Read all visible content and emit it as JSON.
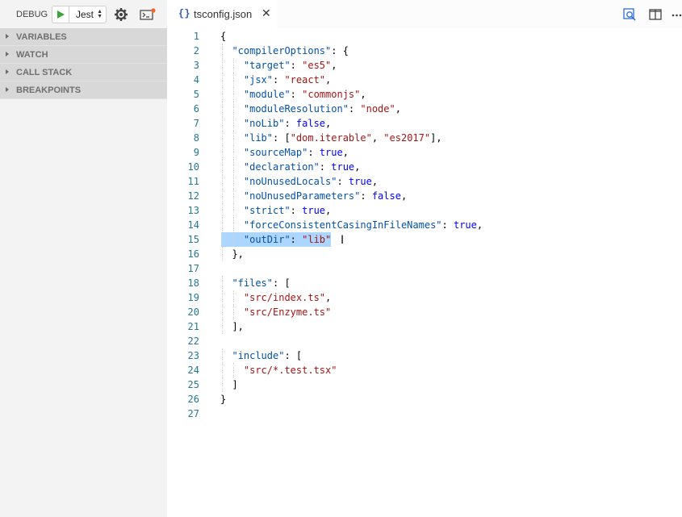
{
  "debug": {
    "label": "DEBUG",
    "configuration": "Jest",
    "sections": [
      {
        "label": "VARIABLES"
      },
      {
        "label": "WATCH"
      },
      {
        "label": "CALL STACK"
      },
      {
        "label": "BREAKPOINTS"
      }
    ]
  },
  "editor": {
    "tab": {
      "icon": "{}",
      "label": "tsconfig.json",
      "close": "✕"
    },
    "cursor": "I",
    "lines": [
      {
        "n": "1",
        "t": [
          {
            "c": "p",
            "v": "{"
          }
        ]
      },
      {
        "n": "2",
        "t": [
          {
            "c": "k",
            "v": "\"compilerOptions\""
          },
          {
            "c": "p",
            "v": ": {"
          }
        ]
      },
      {
        "n": "3",
        "t": [
          {
            "c": "k",
            "v": "\"target\""
          },
          {
            "c": "p",
            "v": ": "
          },
          {
            "c": "s",
            "v": "\"es5\""
          },
          {
            "c": "p",
            "v": ","
          }
        ]
      },
      {
        "n": "4",
        "t": [
          {
            "c": "k",
            "v": "\"jsx\""
          },
          {
            "c": "p",
            "v": ": "
          },
          {
            "c": "s",
            "v": "\"react\""
          },
          {
            "c": "p",
            "v": ","
          }
        ]
      },
      {
        "n": "5",
        "t": [
          {
            "c": "k",
            "v": "\"module\""
          },
          {
            "c": "p",
            "v": ": "
          },
          {
            "c": "s",
            "v": "\"commonjs\""
          },
          {
            "c": "p",
            "v": ","
          }
        ]
      },
      {
        "n": "6",
        "t": [
          {
            "c": "k",
            "v": "\"moduleResolution\""
          },
          {
            "c": "p",
            "v": ": "
          },
          {
            "c": "s",
            "v": "\"node\""
          },
          {
            "c": "p",
            "v": ","
          }
        ]
      },
      {
        "n": "7",
        "t": [
          {
            "c": "k",
            "v": "\"noLib\""
          },
          {
            "c": "p",
            "v": ": "
          },
          {
            "c": "b",
            "v": "false"
          },
          {
            "c": "p",
            "v": ","
          }
        ]
      },
      {
        "n": "8",
        "t": [
          {
            "c": "k",
            "v": "\"lib\""
          },
          {
            "c": "p",
            "v": ": ["
          },
          {
            "c": "s",
            "v": "\"dom.iterable\""
          },
          {
            "c": "p",
            "v": ", "
          },
          {
            "c": "s",
            "v": "\"es2017\""
          },
          {
            "c": "p",
            "v": "],"
          }
        ]
      },
      {
        "n": "9",
        "t": [
          {
            "c": "k",
            "v": "\"sourceMap\""
          },
          {
            "c": "p",
            "v": ": "
          },
          {
            "c": "b",
            "v": "true"
          },
          {
            "c": "p",
            "v": ","
          }
        ]
      },
      {
        "n": "10",
        "t": [
          {
            "c": "k",
            "v": "\"declaration\""
          },
          {
            "c": "p",
            "v": ": "
          },
          {
            "c": "b",
            "v": "true"
          },
          {
            "c": "p",
            "v": ","
          }
        ]
      },
      {
        "n": "11",
        "t": [
          {
            "c": "k",
            "v": "\"noUnusedLocals\""
          },
          {
            "c": "p",
            "v": ": "
          },
          {
            "c": "b",
            "v": "true"
          },
          {
            "c": "p",
            "v": ","
          }
        ]
      },
      {
        "n": "12",
        "t": [
          {
            "c": "k",
            "v": "\"noUnusedParameters\""
          },
          {
            "c": "p",
            "v": ": "
          },
          {
            "c": "b",
            "v": "false"
          },
          {
            "c": "p",
            "v": ","
          }
        ]
      },
      {
        "n": "13",
        "t": [
          {
            "c": "k",
            "v": "\"strict\""
          },
          {
            "c": "p",
            "v": ": "
          },
          {
            "c": "b",
            "v": "true"
          },
          {
            "c": "p",
            "v": ","
          }
        ]
      },
      {
        "n": "14",
        "t": [
          {
            "c": "k",
            "v": "\"forceConsistentCasingInFileNames\""
          },
          {
            "c": "p",
            "v": ": "
          },
          {
            "c": "b",
            "v": "true"
          },
          {
            "c": "p",
            "v": ","
          }
        ]
      },
      {
        "n": "15",
        "t": [
          {
            "c": "k",
            "v": "\"outDir\""
          },
          {
            "c": "p",
            "v": ": "
          },
          {
            "c": "s",
            "v": "\"lib\""
          }
        ]
      },
      {
        "n": "16",
        "t": [
          {
            "c": "p",
            "v": "},"
          }
        ]
      },
      {
        "n": "17",
        "t": []
      },
      {
        "n": "18",
        "t": [
          {
            "c": "k",
            "v": "\"files\""
          },
          {
            "c": "p",
            "v": ": ["
          }
        ]
      },
      {
        "n": "19",
        "t": [
          {
            "c": "s",
            "v": "\"src/index.ts\""
          },
          {
            "c": "p",
            "v": ","
          }
        ]
      },
      {
        "n": "20",
        "t": [
          {
            "c": "s",
            "v": "\"src/Enzyme.ts\""
          }
        ]
      },
      {
        "n": "21",
        "t": [
          {
            "c": "p",
            "v": "],"
          }
        ]
      },
      {
        "n": "22",
        "t": []
      },
      {
        "n": "23",
        "t": [
          {
            "c": "k",
            "v": "\"include\""
          },
          {
            "c": "p",
            "v": ": ["
          }
        ]
      },
      {
        "n": "24",
        "t": [
          {
            "c": "s",
            "v": "\"src/*.test.tsx\""
          }
        ]
      },
      {
        "n": "25",
        "t": [
          {
            "c": "p",
            "v": "]"
          }
        ]
      },
      {
        "n": "26",
        "t": [
          {
            "c": "p",
            "v": "}"
          }
        ]
      },
      {
        "n": "27",
        "t": []
      }
    ]
  }
}
